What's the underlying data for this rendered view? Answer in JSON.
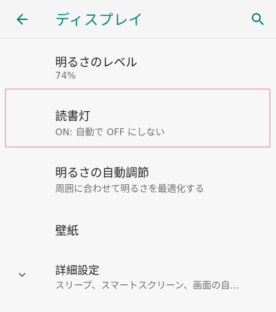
{
  "appbar": {
    "title": "ディスプレイ",
    "back_icon": "arrow-left-icon",
    "search_icon": "search-icon",
    "accent": "#00857a"
  },
  "settings": {
    "brightness": {
      "title": "明るさのレベル",
      "summary": "74%"
    },
    "night_light": {
      "title": "読書灯",
      "summary": "ON: 自動で OFF にしない"
    },
    "adaptive_brightness": {
      "title": "明るさの自動調節",
      "summary": "周囲に合わせて明るさを最適化する"
    },
    "wallpaper": {
      "title": "壁紙"
    },
    "advanced": {
      "title": "詳細設定",
      "summary": "スリープ、スマートスクリーン、画面の自...",
      "expand_icon": "chevron-down-icon"
    }
  }
}
